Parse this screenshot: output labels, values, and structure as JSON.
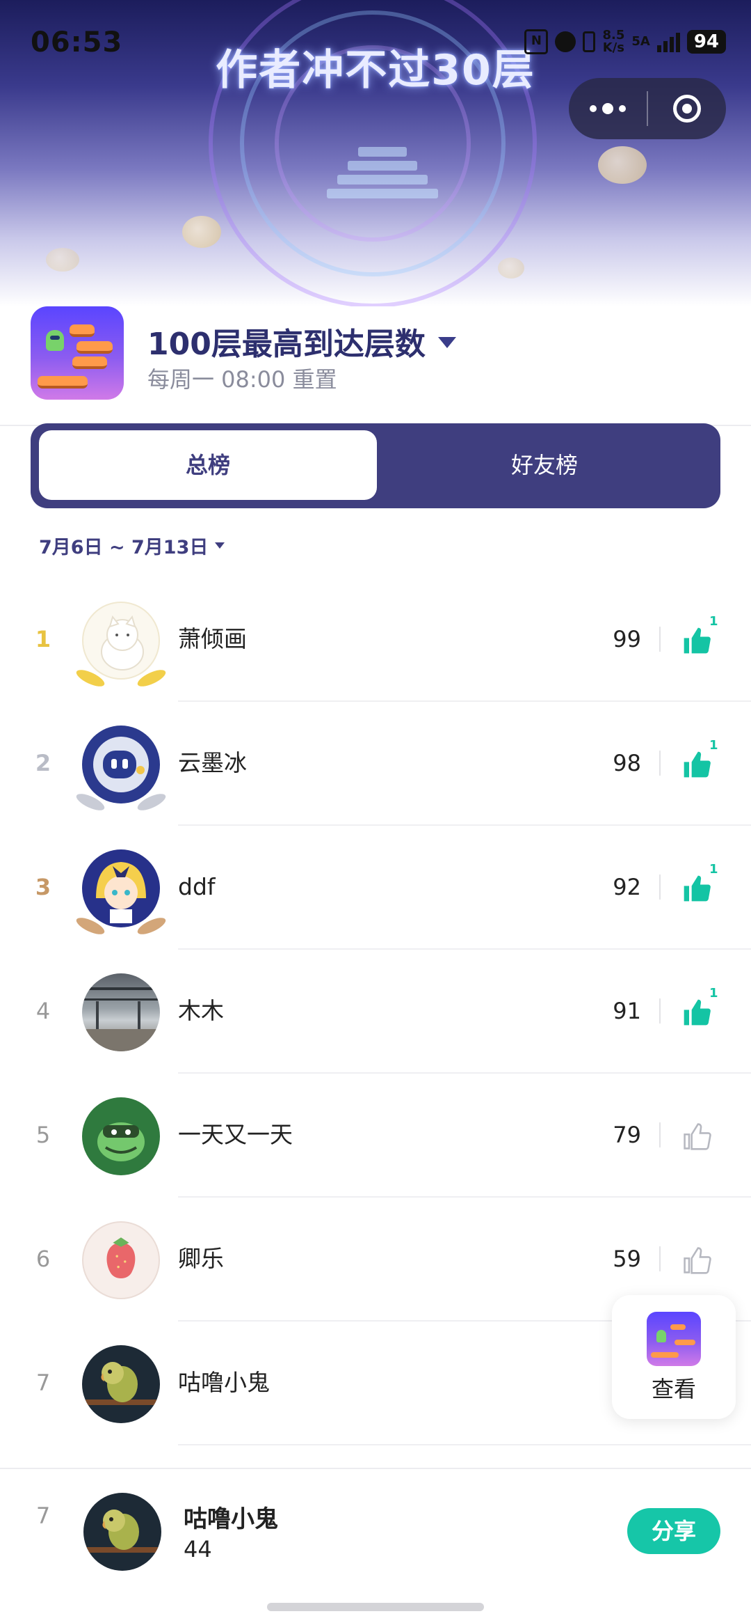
{
  "status_bar": {
    "time": "06:53",
    "net_speed_top": "8.5",
    "net_speed_bottom": "K/s",
    "network": "5A",
    "battery": "94"
  },
  "hero": {
    "title": "作者冲不过30层"
  },
  "game": {
    "title": "100层最高到达层数",
    "subtitle": "每周一 08:00 重置"
  },
  "tabs": [
    {
      "label": "总榜",
      "active": true
    },
    {
      "label": "好友榜",
      "active": false
    }
  ],
  "date_range": "7月6日 ~ 7月13日",
  "leaderboard": [
    {
      "rank": "1",
      "name": "萧倾画",
      "score": "99",
      "likes": "1",
      "liked": true
    },
    {
      "rank": "2",
      "name": "云墨冰",
      "score": "98",
      "likes": "1",
      "liked": true
    },
    {
      "rank": "3",
      "name": "ddf",
      "score": "92",
      "likes": "1",
      "liked": true
    },
    {
      "rank": "4",
      "name": "木木",
      "score": "91",
      "likes": "1",
      "liked": true
    },
    {
      "rank": "5",
      "name": "一天又一天",
      "score": "79",
      "likes": "",
      "liked": false
    },
    {
      "rank": "6",
      "name": "卿乐",
      "score": "59",
      "likes": "",
      "liked": false
    },
    {
      "rank": "7",
      "name": "咕噜小鬼",
      "score": "",
      "likes": "",
      "liked": false
    }
  ],
  "float_view": {
    "label": "查看"
  },
  "my_rank": {
    "rank": "7",
    "name": "咕噜小鬼",
    "score": "44",
    "share_label": "分享"
  },
  "colors": {
    "accent": "#3f3e7f",
    "like_active": "#14c4a4",
    "share": "#16c6a8"
  }
}
